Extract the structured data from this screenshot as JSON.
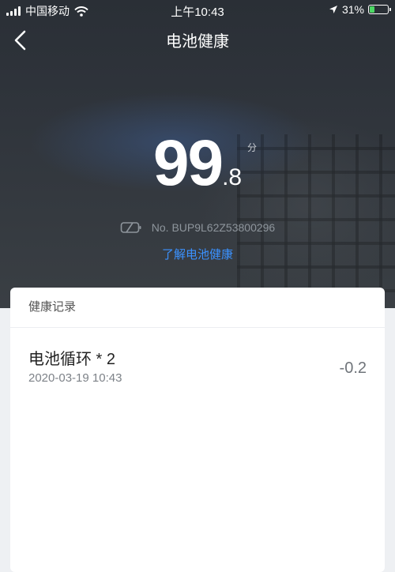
{
  "status_bar": {
    "carrier": "中国移动",
    "time": "上午10:43",
    "battery_percent": "31%",
    "battery_level": 0.31,
    "battery_color": "#4cd964"
  },
  "nav": {
    "title": "电池健康",
    "back_icon": "chevron-left-icon"
  },
  "score": {
    "integer": "99",
    "decimal": ".8",
    "unit": "分"
  },
  "serial": {
    "icon": "battery-outline-icon",
    "text": "No. BUP9L62Z53800296"
  },
  "learn_link": {
    "text": "了解电池健康",
    "color": "#3b92ff"
  },
  "records": {
    "header": "健康记录",
    "items": [
      {
        "title": "电池循环 * 2",
        "date": "2020-03-19 10:43",
        "delta": "-0.2"
      }
    ]
  }
}
